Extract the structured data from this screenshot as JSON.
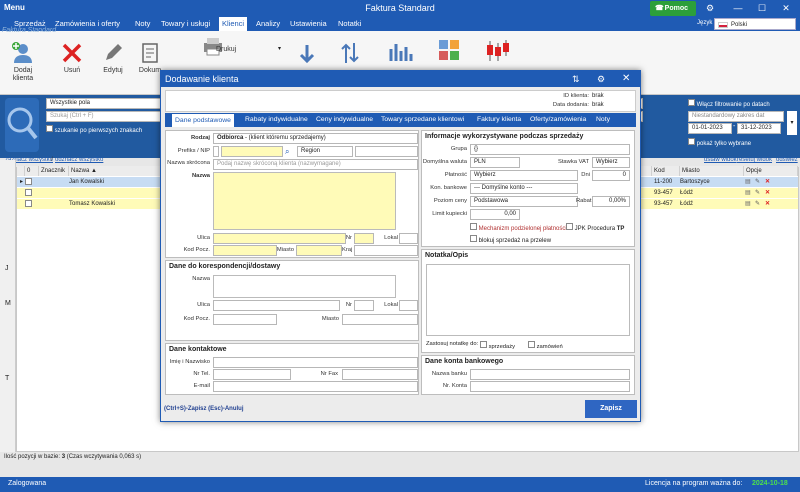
{
  "app": {
    "menu": "Menu",
    "title": "Faktura  Standard",
    "help": "Pomoc",
    "lang_label": "Język",
    "lang_value": "Polski"
  },
  "menubar": [
    "Sprzedaż",
    "Zamówienia i oferty",
    "Noty",
    "Towary i usługi",
    "Klienci",
    "Analizy",
    "Ustawienia",
    "Notatki"
  ],
  "toolbar": {
    "add": "Dodaj klienta",
    "delete": "Usuń",
    "edit": "Edytuj",
    "docs": "Dokum",
    "print": "Drukuj",
    "watermark": "Faktura Standard"
  },
  "filters": {
    "field": "Wszystkie pola",
    "search_ph": "Szukaj (Ctrl + F)",
    "first_chars": "szukanie po pierwszych znakach",
    "enable_date": "Włącz filtrowanie po datach",
    "nonstandard": "Niestandardowy zakres dat",
    "date_from": "01-01-2023",
    "date_to": "31-12-2023",
    "only_selected": "pokaż tylko wybrane"
  },
  "grid": {
    "select_all": "zaznacz wszystko",
    "deselect_all": "odznacz wszystko",
    "layout": "ustaw widok",
    "reset": "resetuj widok",
    "refresh": "odśwież",
    "headers": {
      "zero": "0",
      "marker": "Znacznik",
      "name": "Nazwa",
      "code": "Kod",
      "city": "Miasto",
      "options": "Opcje"
    },
    "rows": [
      {
        "name": "Jan Kowalski",
        "code": "11-200",
        "city": "Bartoszyce"
      },
      {
        "name": "",
        "code": "93-457",
        "city": "Łódź"
      },
      {
        "name": "Tomasz Kowalski",
        "code": "93-457",
        "city": "Łódź"
      }
    ],
    "left_letters": [
      "J",
      "M",
      "T"
    ]
  },
  "status": {
    "count_label": "Ilość pozycji w bazie:",
    "count": "3",
    "time": "(Czas wczytywania 0,063 s)",
    "logged": "Zalogowana",
    "license": "Licencja na program ważna do:",
    "license_date": "2024-10-18"
  },
  "modal": {
    "title": "Dodawanie klienta",
    "id_label": "ID klienta:",
    "id_value": "brak",
    "date_label": "Data dodania:",
    "date_value": "brak",
    "tabs": [
      "Dane podstawowe",
      "Rabaty indywidualne",
      "Ceny indywidualne",
      "Towary sprzedane klientowi",
      "Faktury klienta",
      "Oferty/zamówienia",
      "Noty"
    ],
    "basic": {
      "rodzaj": "Rodzaj",
      "rodzaj_value": "Odbiorca",
      "rodzaj_hint": "- (klient któremu sprzedajemy)",
      "prefix": "Prefiks / NIP",
      "region": "Region",
      "short": "Nazwa skrócona",
      "short_ph": "Podaj nazwę skróconą klienta (nazwymagane)",
      "name": "Nazwa",
      "street": "Ulica",
      "nr": "Nr",
      "lokal": "Lokal",
      "postal": "Kod Pocz.",
      "city": "Miasto",
      "country": "Kraj"
    },
    "corr": {
      "title": "Dane do korespondencji/dostawy",
      "name": "Nazwa",
      "street": "Ulica",
      "nr": "Nr",
      "lokal": "Lokal",
      "postal": "Kod Pocz.",
      "city": "Miasto"
    },
    "contact": {
      "title": "Dane kontaktowe",
      "person": "Imię i Nazwisko",
      "tel": "Nr Tel.",
      "fax": "Nr Fax",
      "email": "E-mail"
    },
    "sales": {
      "title": "Informacje wykorzystywane podczas sprzedaży",
      "group": "Grupa",
      "group_value": "{}",
      "currency": "Domyślna waluta",
      "currency_value": "PLN",
      "vat": "Stawka VAT",
      "vat_value": "Wybierz",
      "payment": "Płatność",
      "payment_value": "Wybierz",
      "days": "Dni",
      "days_value": "0",
      "bank": "Kon. bankowe",
      "bank_value": "--- Domyślne konto ---",
      "price": "Poziom ceny",
      "price_value": "Podstawowa",
      "discount": "Rabat",
      "discount_value": "0,00%",
      "limit": "Limit kupiecki",
      "limit_value": "0,00",
      "split": "Mechanizm podzielonej płatności",
      "jpk": "JPK Procedura",
      "jpk_tp": "TP",
      "block": "blokuj sprzedaż na przelew"
    },
    "note": {
      "title": "Notatka/Opis",
      "apply": "Zastosuj notatkę do:",
      "sales": "sprzedaży",
      "orders": "zamówień"
    },
    "bankacc": {
      "title": "Dane konta bankowego",
      "bank": "Nazwa banku",
      "acc": "Nr. Konta"
    },
    "shortcuts": "(Ctrl+S)-Zapisz (Esc)-Anuluj",
    "save": "Zapisz"
  }
}
